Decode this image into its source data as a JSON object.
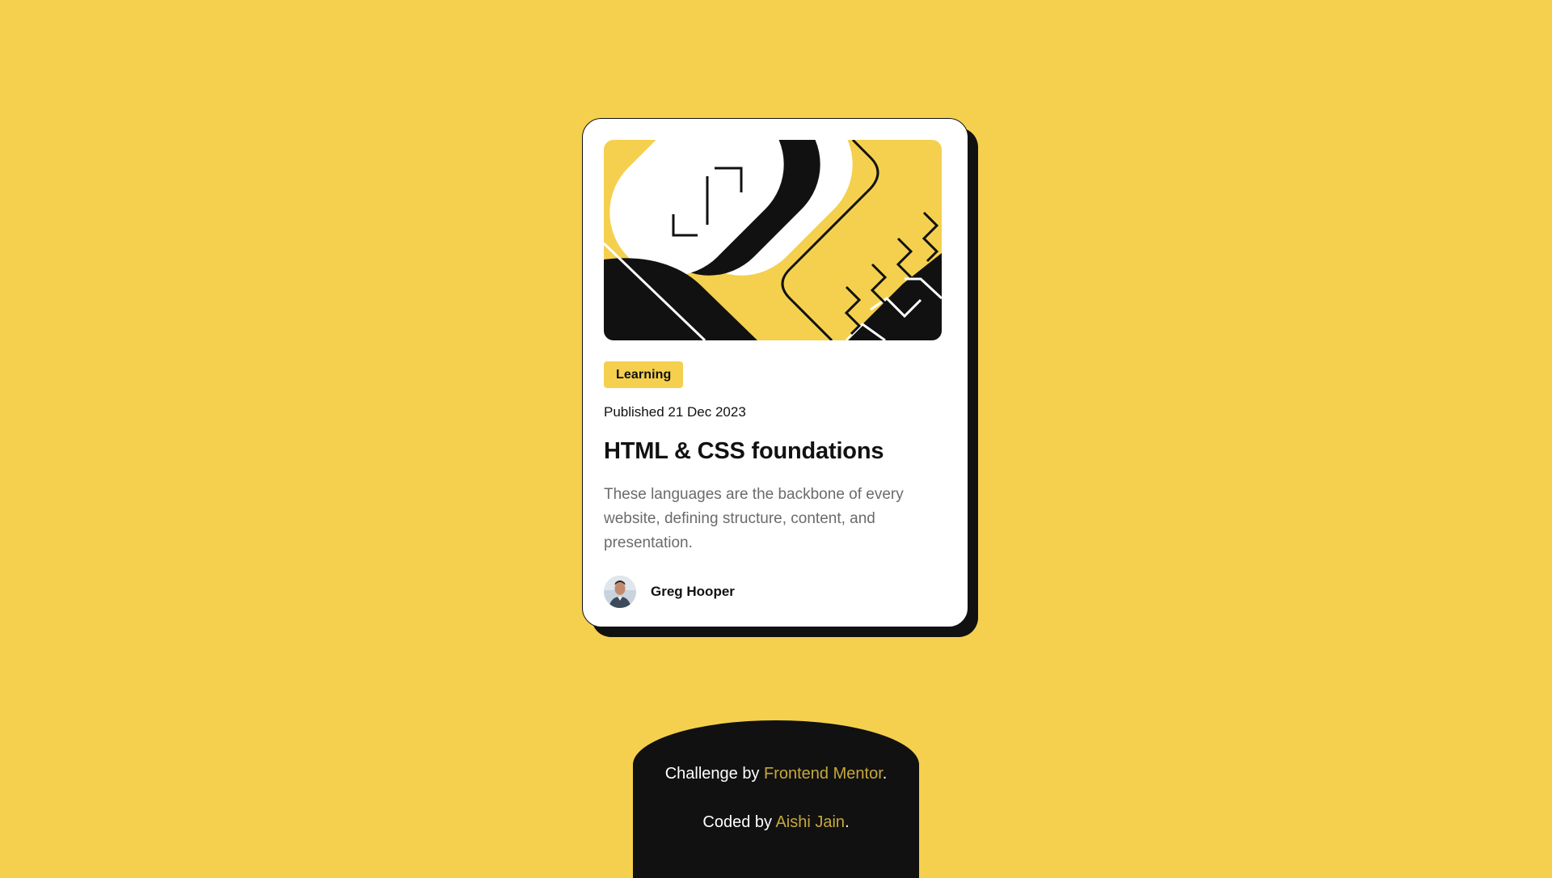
{
  "colors": {
    "background": "#F4D04E",
    "card": "#FFFFFF",
    "ink": "#111111",
    "muted_text": "#6B6B6B",
    "link": "#C6A83C"
  },
  "card": {
    "hero_image": "abstract-illustration",
    "tag": "Learning",
    "published": "Published 21 Dec 2023",
    "title": "HTML & CSS foundations",
    "description": "These languages are the backbone of every website, defining structure, content, and presentation.",
    "author": {
      "avatar_icon": "avatar-photo",
      "name": "Greg Hooper"
    }
  },
  "footer": {
    "line1_prefix": "Challenge by ",
    "line1_link": "Frontend Mentor",
    "line1_suffix": ".",
    "line2_prefix": "Coded by ",
    "line2_link": "Aishi Jain",
    "line2_suffix": "."
  }
}
